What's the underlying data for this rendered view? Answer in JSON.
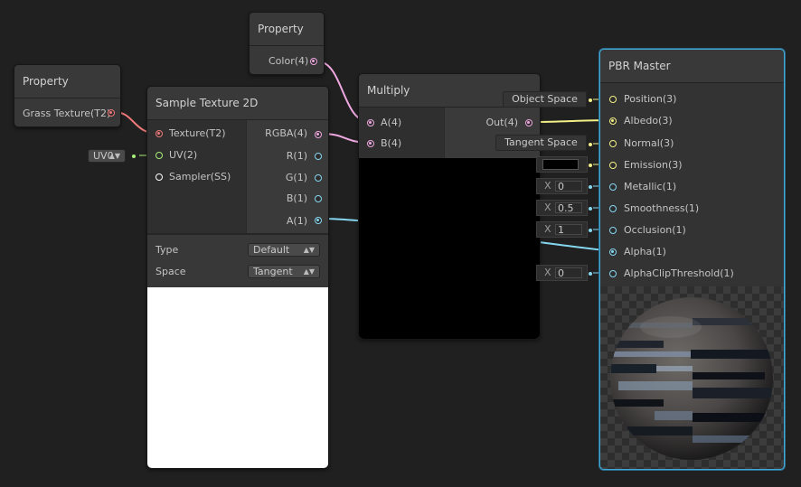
{
  "colors": {
    "texture_port": "#f07a7a",
    "vector4_port": "#f0a8e0",
    "vector3_port": "#f4f088",
    "vector2_port": "#a8f07c",
    "vector1_port": "#86d8f0",
    "sampler_port": "#ffffff",
    "selection": "#44a8d6"
  },
  "property_texture": {
    "title": "Property",
    "output": "Grass Texture(T2)"
  },
  "property_color": {
    "title": "Property",
    "output": "Color(4)"
  },
  "uv_dropdown": {
    "value": "UV0"
  },
  "sample_texture": {
    "title": "Sample Texture 2D",
    "inputs": [
      "Texture(T2)",
      "UV(2)",
      "Sampler(SS)"
    ],
    "outputs": [
      "RGBA(4)",
      "R(1)",
      "G(1)",
      "B(1)",
      "A(1)"
    ],
    "type_label": "Type",
    "type_value": "Default",
    "space_label": "Space",
    "space_value": "Tangent"
  },
  "multiply": {
    "title": "Multiply",
    "inputs": [
      "A(4)",
      "B(4)"
    ],
    "output": "Out(4)"
  },
  "pbr_master": {
    "title": "PBR Master",
    "inputs": [
      "Position(3)",
      "Albedo(3)",
      "Normal(3)",
      "Emission(3)",
      "Metallic(1)",
      "Smoothness(1)",
      "Occlusion(1)",
      "Alpha(1)",
      "AlphaClipThreshold(1)"
    ],
    "position_space": "Object Space",
    "normal_space": "Tangent Space",
    "metallic_value": "0",
    "smoothness_value": "0.5",
    "occlusion_value": "1",
    "alphaclip_value": "0",
    "x_label": "X"
  }
}
